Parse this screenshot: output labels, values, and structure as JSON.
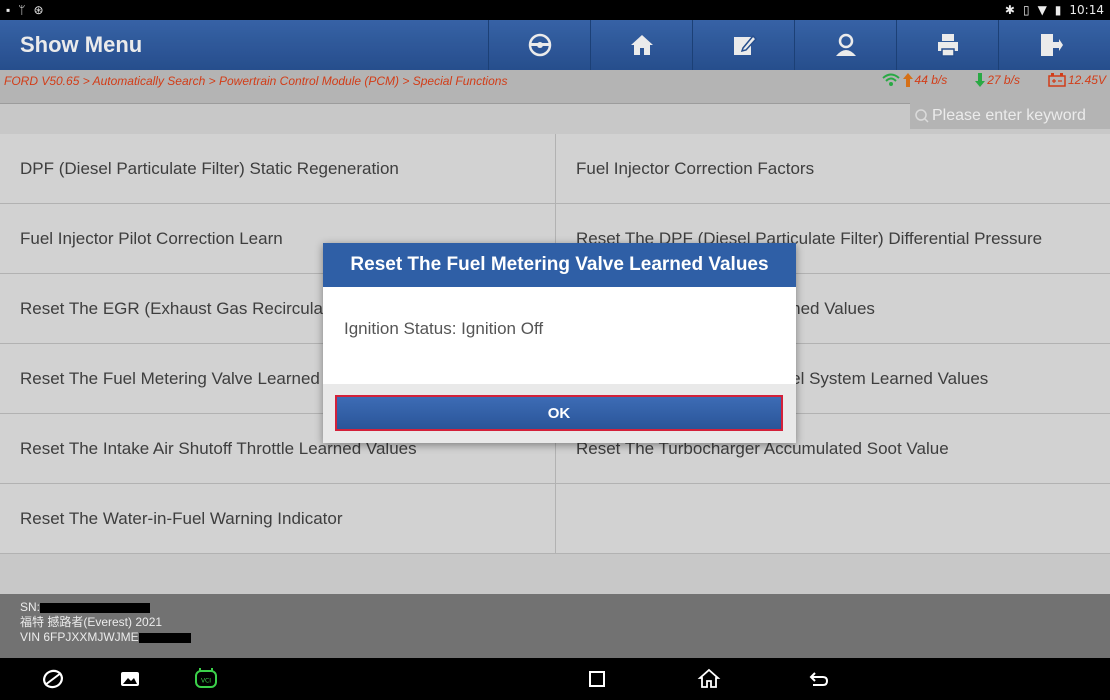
{
  "statusbar": {
    "time": "10:14"
  },
  "header": {
    "title": "Show Menu",
    "tools": [
      "steering-wheel-icon",
      "home-icon",
      "edit-report-icon",
      "user-icon",
      "printer-icon",
      "exit-icon"
    ]
  },
  "breadcrumb": "FORD V50.65 > Automatically Search > Powertrain Control Module (PCM) > Special Functions",
  "netstats": {
    "up": "44 b/s",
    "down": "27 b/s",
    "battery": "12.45V"
  },
  "search": {
    "placeholder": "Please enter keyword"
  },
  "menu": {
    "rows": [
      [
        "DPF (Diesel Particulate Filter) Static Regeneration",
        "Fuel Injector Correction Factors"
      ],
      [
        "Fuel Injector Pilot Correction Learn",
        "Reset The DPF (Diesel Particulate Filter) Differential Pressure"
      ],
      [
        "Reset The EGR (Exhaust Gas Recirculation) Learned Values",
        "Reset The Fuel Injector Learned Values"
      ],
      [
        "Reset The Fuel Metering Valve Learned Values",
        "Reset The High Pressure Fuel System Learned Values"
      ],
      [
        "Reset The Intake Air Shutoff Throttle Learned Values",
        "Reset The Turbocharger Accumulated Soot Value"
      ],
      [
        "Reset The Water-in-Fuel Warning Indicator",
        ""
      ]
    ]
  },
  "footer": {
    "sn_label": "SN:",
    "vehicle": "福特 撼路者(Everest) 2021",
    "vin_label": "VIN 6FPJXXMJWJME"
  },
  "dialog": {
    "title": "Reset The Fuel Metering Valve Learned Values",
    "message": "Ignition Status: Ignition Off",
    "ok_label": "OK"
  }
}
